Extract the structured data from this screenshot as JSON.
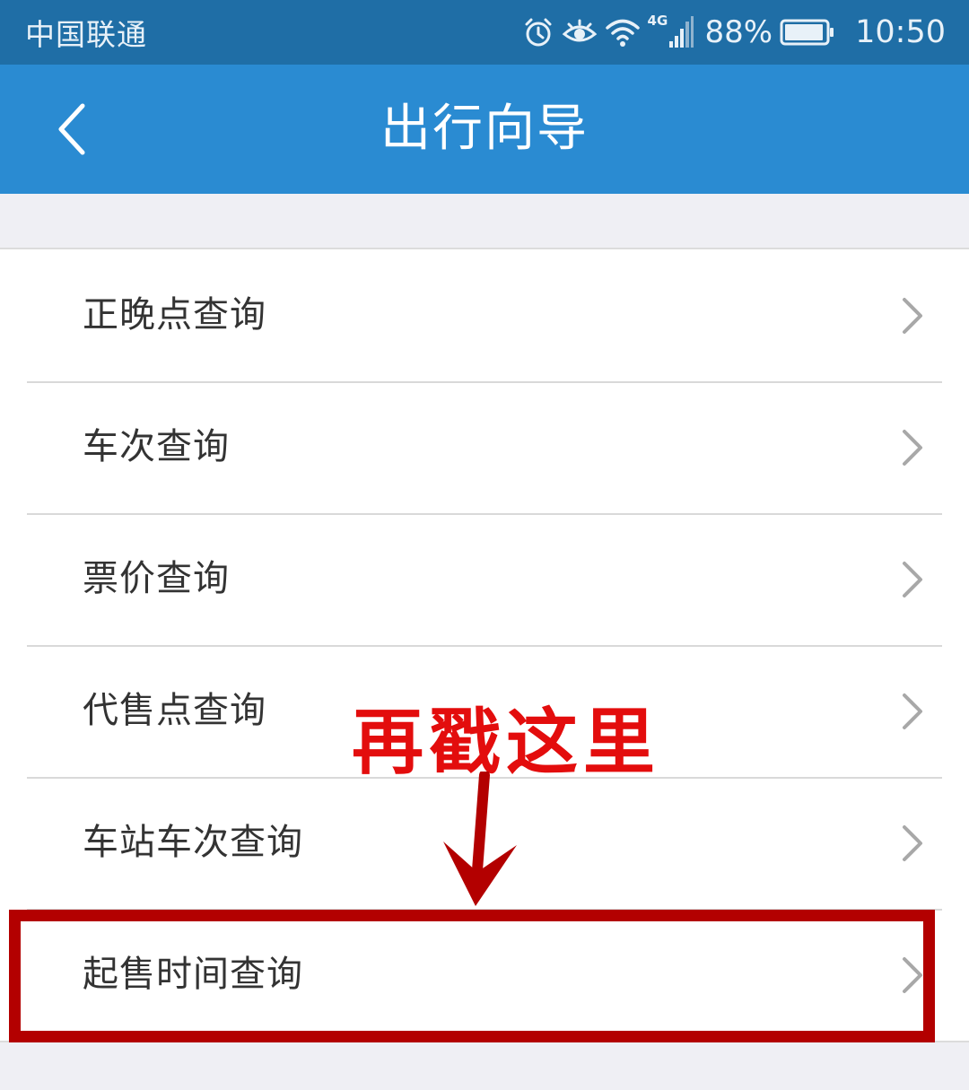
{
  "status_bar": {
    "carrier": "中国联通",
    "network": "4G",
    "battery": "88%",
    "time": "10:50",
    "icons": [
      "alarm-icon",
      "eye-icon",
      "wifi-icon",
      "signal-icon",
      "battery-icon"
    ]
  },
  "header": {
    "title": "出行向导",
    "back_icon": "chevron-left-icon"
  },
  "menu": {
    "items": [
      {
        "label": "正晚点查询"
      },
      {
        "label": "车次查询"
      },
      {
        "label": "票价查询"
      },
      {
        "label": "代售点查询"
      },
      {
        "label": "车站车次查询"
      },
      {
        "label": "起售时间查询"
      }
    ],
    "chevron_icon": "chevron-right-icon"
  },
  "annotation": {
    "text": "再戳这里",
    "color": "#e30d0d",
    "box_color": "#b30000"
  },
  "colors": {
    "status_bar": "#1f6ea6",
    "header": "#2a8bd2",
    "background": "#efeff4"
  }
}
